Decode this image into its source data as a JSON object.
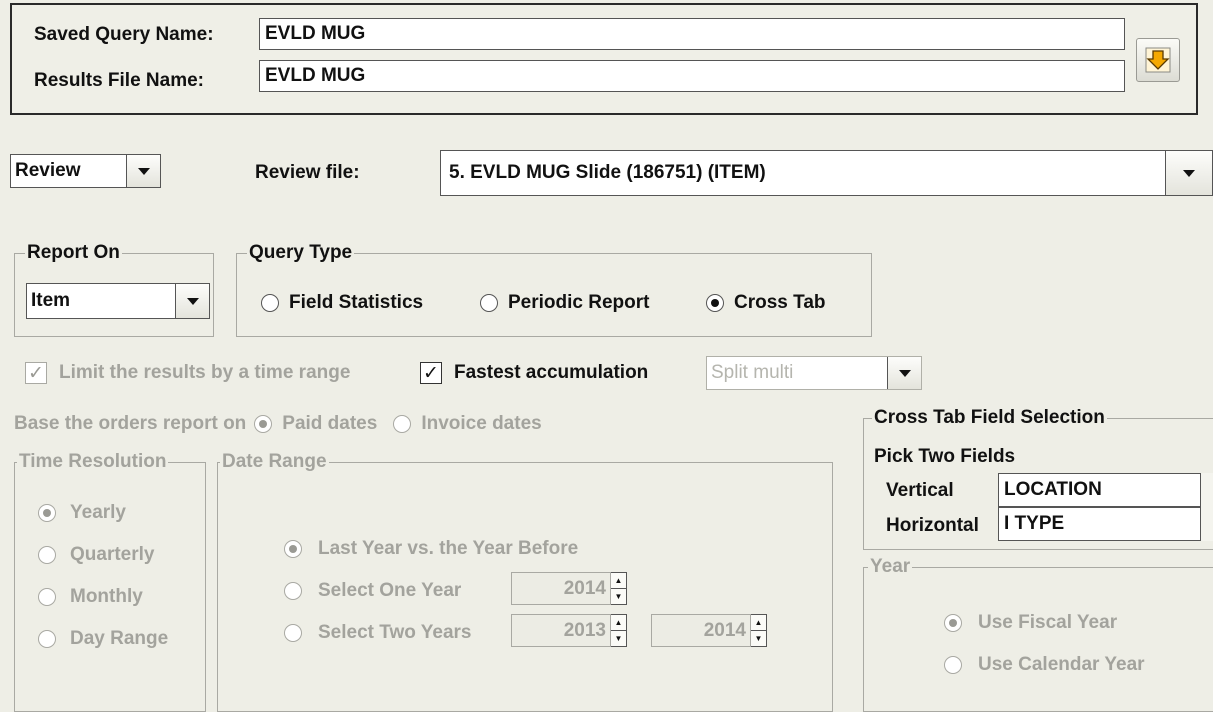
{
  "header": {
    "saved_query_label": "Saved Query Name:",
    "saved_query_value": "EVLD MUG",
    "results_file_label": "Results File Name:",
    "results_file_value": "EVLD MUG",
    "save_icon": "down-arrow-icon",
    "save_icon_color": "#f5a800"
  },
  "review": {
    "mode_value": "Review",
    "file_label": "Review file:",
    "file_value": "5. EVLD MUG Slide (186751) (ITEM)"
  },
  "report_on": {
    "legend": "Report On",
    "value": "Item"
  },
  "query_type": {
    "legend": "Query Type",
    "options": [
      "Field Statistics",
      "Periodic Report",
      "Cross Tab"
    ],
    "selected": "Cross Tab"
  },
  "options_row": {
    "limit_label": "Limit the results by a time range",
    "limit_checked": true,
    "fastest_label": "Fastest accumulation",
    "fastest_checked": true,
    "split_value": "Split multi"
  },
  "base_orders": {
    "label": "Base the orders report on",
    "options": [
      "Paid dates",
      "Invoice dates"
    ],
    "selected": "Paid dates"
  },
  "time_resolution": {
    "legend": "Time Resolution",
    "options": [
      "Yearly",
      "Quarterly",
      "Monthly",
      "Day Range"
    ],
    "selected": "Yearly"
  },
  "date_range": {
    "legend": "Date Range",
    "options": [
      "Last Year vs. the Year Before",
      "Select One Year",
      "Select Two Years"
    ],
    "selected": "Last Year vs. the Year Before",
    "one_year": "2014",
    "two_years_from": "2013",
    "two_years_to": "2014"
  },
  "cross_tab": {
    "legend": "Cross Tab Field Selection",
    "subtitle": "Pick Two Fields",
    "vertical_label": "Vertical",
    "vertical_value": "LOCATION",
    "horizontal_label": "Horizontal",
    "horizontal_value": "I TYPE"
  },
  "year": {
    "legend": "Year",
    "options": [
      "Use Fiscal Year",
      "Use Calendar Year"
    ],
    "selected": "Use Fiscal Year"
  }
}
